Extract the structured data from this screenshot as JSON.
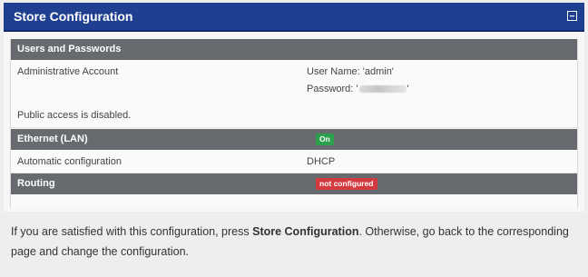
{
  "panel": {
    "title": "Store Configuration",
    "collapse_icon": "minus-square-icon"
  },
  "users": {
    "heading": "Users and Passwords",
    "admin_label": "Administrative Account",
    "username_prefix": "User Name: ",
    "username_value": "'admin'",
    "password_prefix": "Password: '",
    "password_suffix": "'",
    "public_access": "Public access is disabled."
  },
  "ethernet": {
    "heading": "Ethernet (LAN)",
    "status": "On",
    "status_color": "#2aa14a",
    "auto_config_label": "Automatic configuration",
    "auto_config_value": "DHCP"
  },
  "routing": {
    "heading": "Routing",
    "status": "not configured",
    "status_color": "#d23a3f"
  },
  "note": {
    "text_before": "If you are satisfied with this configuration, press ",
    "emphasis": "Store Configuration",
    "text_after": ". Otherwise, go back to the corresponding page and change the configuration."
  },
  "colors": {
    "titlebar": "#1f3f90",
    "section_header": "#676b70"
  }
}
